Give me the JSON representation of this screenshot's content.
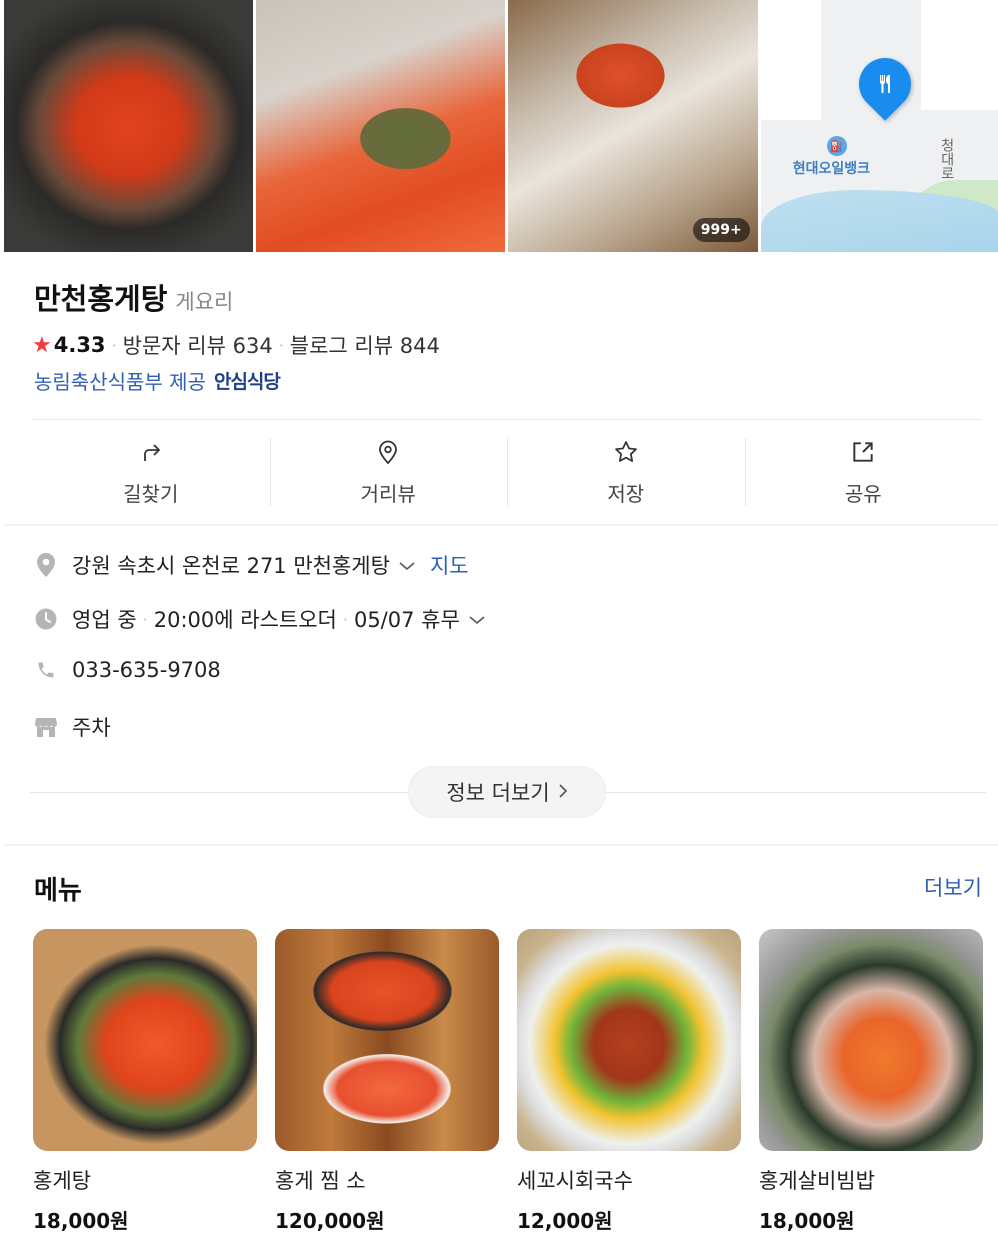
{
  "gallery": {
    "photo_count_badge": "999+",
    "map_poi_label": "현대오일뱅크",
    "map_road_label": "청대로"
  },
  "place": {
    "name": "만천홍게탕",
    "category": "게요리",
    "rating": "4.33",
    "visitor_reviews": "방문자 리뷰 634",
    "blog_reviews": "블로그 리뷰 844",
    "provider": "농림축산식품부 제공",
    "safe_badge": "안심식당"
  },
  "actions": {
    "directions": "길찾기",
    "street_view": "거리뷰",
    "save": "저장",
    "share": "공유"
  },
  "details": {
    "address": "강원 속초시 온천로 271 만천홍게탕",
    "map_link": "지도",
    "status": "영업 중",
    "last_order": "20:00에 라스트오더",
    "holiday": "05/07 휴무",
    "phone": "033-635-9708",
    "parking": "주차",
    "more_info_button": "정보 더보기"
  },
  "menu": {
    "title": "메뉴",
    "more_link": "더보기",
    "items": [
      {
        "name": "홍게탕",
        "price": "18,000원"
      },
      {
        "name": "홍게 찜 소",
        "price": "120,000원"
      },
      {
        "name": "세꼬시회국수",
        "price": "12,000원"
      },
      {
        "name": "홍게살비빔밥",
        "price": "18,000원"
      }
    ]
  },
  "colors": {
    "accent_link": "#2f5fb3",
    "star": "#f23c3c",
    "map_pin": "#1a8cf0"
  }
}
